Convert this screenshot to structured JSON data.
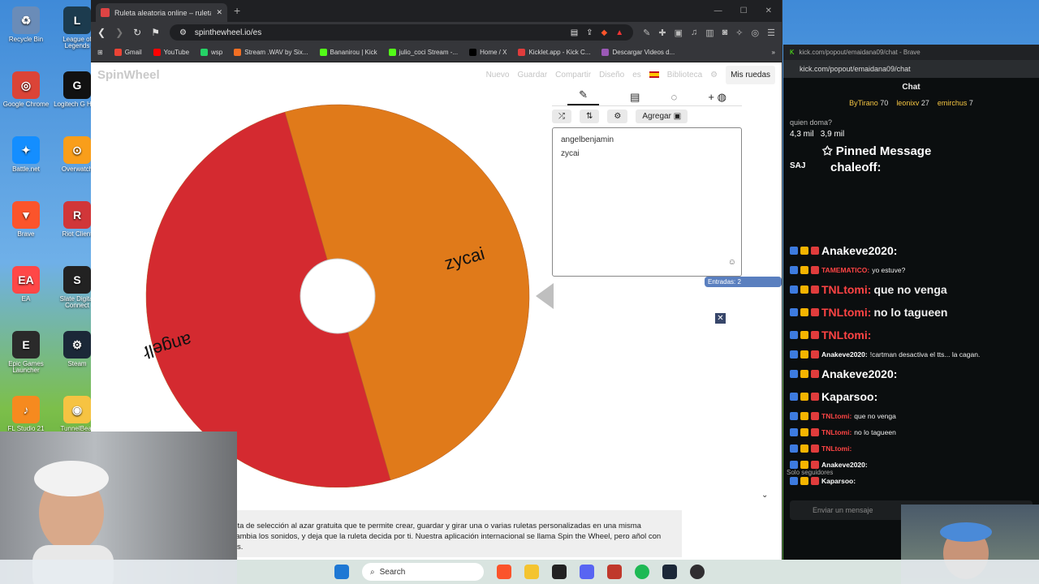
{
  "desktop": {
    "icons": [
      {
        "label": "Recycle Bin",
        "color": "#6a8cb8",
        "glyph": "♻"
      },
      {
        "label": "League of Legends",
        "color": "#1c3b4e",
        "glyph": "L"
      },
      {
        "label": "Google Chrome",
        "color": "#db4437",
        "glyph": "◎"
      },
      {
        "label": "Logitech G HUB",
        "color": "#111111",
        "glyph": "G"
      },
      {
        "label": "Battle.net",
        "color": "#148eff",
        "glyph": "✦"
      },
      {
        "label": "Overwatch",
        "color": "#f99e1a",
        "glyph": "⊙"
      },
      {
        "label": "Brave",
        "color": "#fb542b",
        "glyph": "▼"
      },
      {
        "label": "Riot Client",
        "color": "#d13639",
        "glyph": "R"
      },
      {
        "label": "EA",
        "color": "#ff4747",
        "glyph": "EA"
      },
      {
        "label": "Slate Digital Connect",
        "color": "#222222",
        "glyph": "S"
      },
      {
        "label": "Epic Games Launcher",
        "color": "#2a2a2a",
        "glyph": "E"
      },
      {
        "label": "Steam",
        "color": "#1b2838",
        "glyph": "⚙"
      },
      {
        "label": "FL Studio 21",
        "color": "#f68a1f",
        "glyph": "♪"
      },
      {
        "label": "TunnelBear",
        "color": "#f6c342",
        "glyph": "◉"
      }
    ]
  },
  "browser": {
    "tab_title": "Ruleta aleatoria online – ruleta d",
    "url": "spinthewheel.io/es",
    "bookmarks": [
      {
        "label": "Gmail",
        "color": "#ea4335"
      },
      {
        "label": "YouTube",
        "color": "#ff0000"
      },
      {
        "label": "wsp",
        "color": "#25d366"
      },
      {
        "label": "Stream .WAV by Six...",
        "color": "#f26f23"
      },
      {
        "label": "Bananirou | Kick",
        "color": "#53fc18"
      },
      {
        "label": "julio_coci Stream -...",
        "color": "#53fc18"
      },
      {
        "label": "Home / X",
        "color": "#000000"
      },
      {
        "label": "Kicklet.app - Kick C...",
        "color": "#e03c3c"
      },
      {
        "label": "Descargar Videos d...",
        "color": "#9b59b6"
      }
    ]
  },
  "site": {
    "logo": "SpinWheel",
    "nav": [
      "Nuevo",
      "Guardar",
      "Compartir",
      "Diseño",
      "es",
      "Biblioteca"
    ],
    "my_wheels": "Mis ruedas",
    "add_button": "Agregar",
    "entries": [
      "angelbenjamin",
      "zycai"
    ],
    "entry_count": "Entradas: 2",
    "description": "eta online y una herramienta de selección al azar gratuita que te permite crear, guardar y girar una o varias ruletas personalizadas en una misma entradas, aplica temas y cambia los sonidos, y deja que la ruleta decida por ti. Nuestra aplicación internacional se llama Spin the Wheel, pero añol con todas las mismas funciones."
  },
  "wheel": {
    "slices": [
      {
        "label": "zycai",
        "color": "#e07a1a"
      },
      {
        "label": "angelbenjamin",
        "color": "#d42a30"
      }
    ]
  },
  "chat": {
    "window_title": "kick.com/popout/emaidana09/chat - Brave",
    "url": "kick.com/popout/emaidana09/chat",
    "header": "Chat",
    "gifters": [
      {
        "name": "ByTirano",
        "count": "70"
      },
      {
        "name": "leonixv",
        "count": "27"
      },
      {
        "name": "emirchus",
        "count": "7"
      }
    ],
    "poll_question": "quien doma?",
    "poll_values": [
      "4,3 mil",
      "3,9 mil"
    ],
    "pinned_title": "Pinned Message",
    "pinned_sender": "SAJ",
    "pinned_text": "chaleoff:",
    "messages": [
      {
        "user": "Anakeve2020",
        "text": "",
        "color": "#ffffff",
        "big": true
      },
      {
        "user": "TAMEMATICO",
        "text": "yo estuve?",
        "color": "#ff4444",
        "big": false
      },
      {
        "user": "TNLtomi",
        "text": "que no venga",
        "color": "#ff4444",
        "big": true
      },
      {
        "user": "TNLtomi",
        "text": "no lo tagueen",
        "color": "#ff4444",
        "big": true
      },
      {
        "user": "TNLtomi",
        "text": "",
        "color": "#ff4444",
        "big": true
      },
      {
        "user": "Anakeve2020",
        "text": "!cartman desactiva el tts... la cagan.",
        "color": "#ffffff",
        "big": false
      },
      {
        "user": "Anakeve2020",
        "text": "",
        "color": "#ffffff",
        "big": true
      },
      {
        "user": "Kaparsoo",
        "text": "",
        "color": "#ffffff",
        "big": true
      },
      {
        "user": "TNLtomi",
        "text": "que no venga",
        "color": "#ff4444",
        "big": false
      },
      {
        "user": "TNLtomi",
        "text": "no lo tagueen",
        "color": "#ff4444",
        "big": false
      },
      {
        "user": "TNLtomi",
        "text": "",
        "color": "#ff4444",
        "big": false
      },
      {
        "user": "Anakeve2020",
        "text": "",
        "color": "#ffffff",
        "big": false
      },
      {
        "user": "Kaparsoo",
        "text": "",
        "color": "#ffffff",
        "big": false
      }
    ],
    "followers_only": "Solo seguidores",
    "input_placeholder": "Enviar un mensaje"
  },
  "taskbar": {
    "search_label": "Search"
  }
}
